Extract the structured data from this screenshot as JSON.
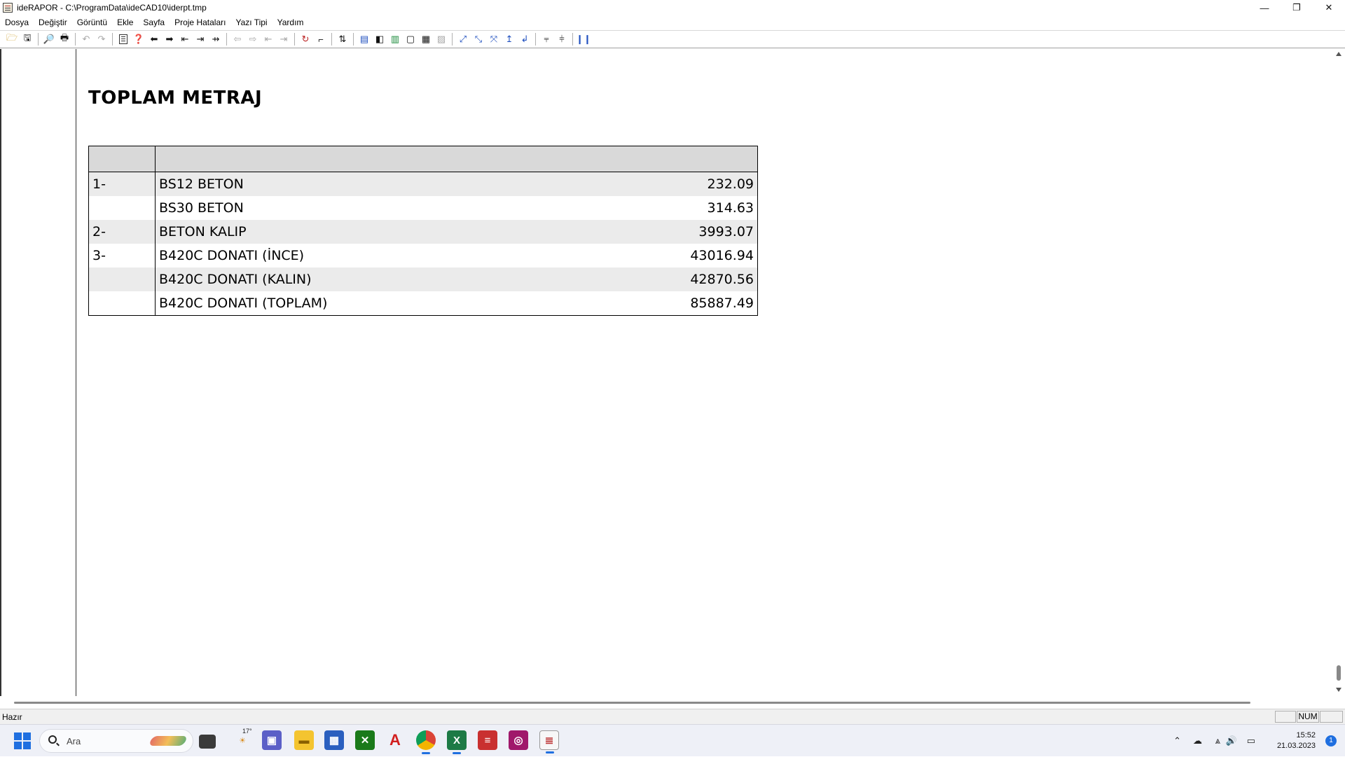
{
  "window": {
    "title": "ideRAPOR - C:\\ProgramData\\ideCAD10\\iderpt.tmp"
  },
  "menu": [
    "Dosya",
    "Değiştir",
    "Görüntü",
    "Ekle",
    "Sayfa",
    "Proje Hataları",
    "Yazı Tipi",
    "Yardım"
  ],
  "report": {
    "title": "TOPLAM METRAJ",
    "rows": [
      {
        "no": "1-",
        "item": "BS12 BETON",
        "value": "232.09"
      },
      {
        "no": "",
        "item": "BS30 BETON",
        "value": "314.63"
      },
      {
        "no": "2-",
        "item": "BETON KALIP",
        "value": "3993.07"
      },
      {
        "no": "3-",
        "item": "B420C DONATI (İNCE)",
        "value": "43016.94"
      },
      {
        "no": "",
        "item": "B420C DONATI (KALIN)",
        "value": "42870.56"
      },
      {
        "no": "",
        "item": "B420C DONATI (TOPLAM)",
        "value": "85887.49"
      }
    ]
  },
  "status": {
    "text": "Hazır",
    "num": "NUM"
  },
  "taskbar": {
    "search_placeholder": "Ara",
    "weather": "17°",
    "time": "15:52",
    "date": "21.03.2023",
    "notifications": "1"
  }
}
